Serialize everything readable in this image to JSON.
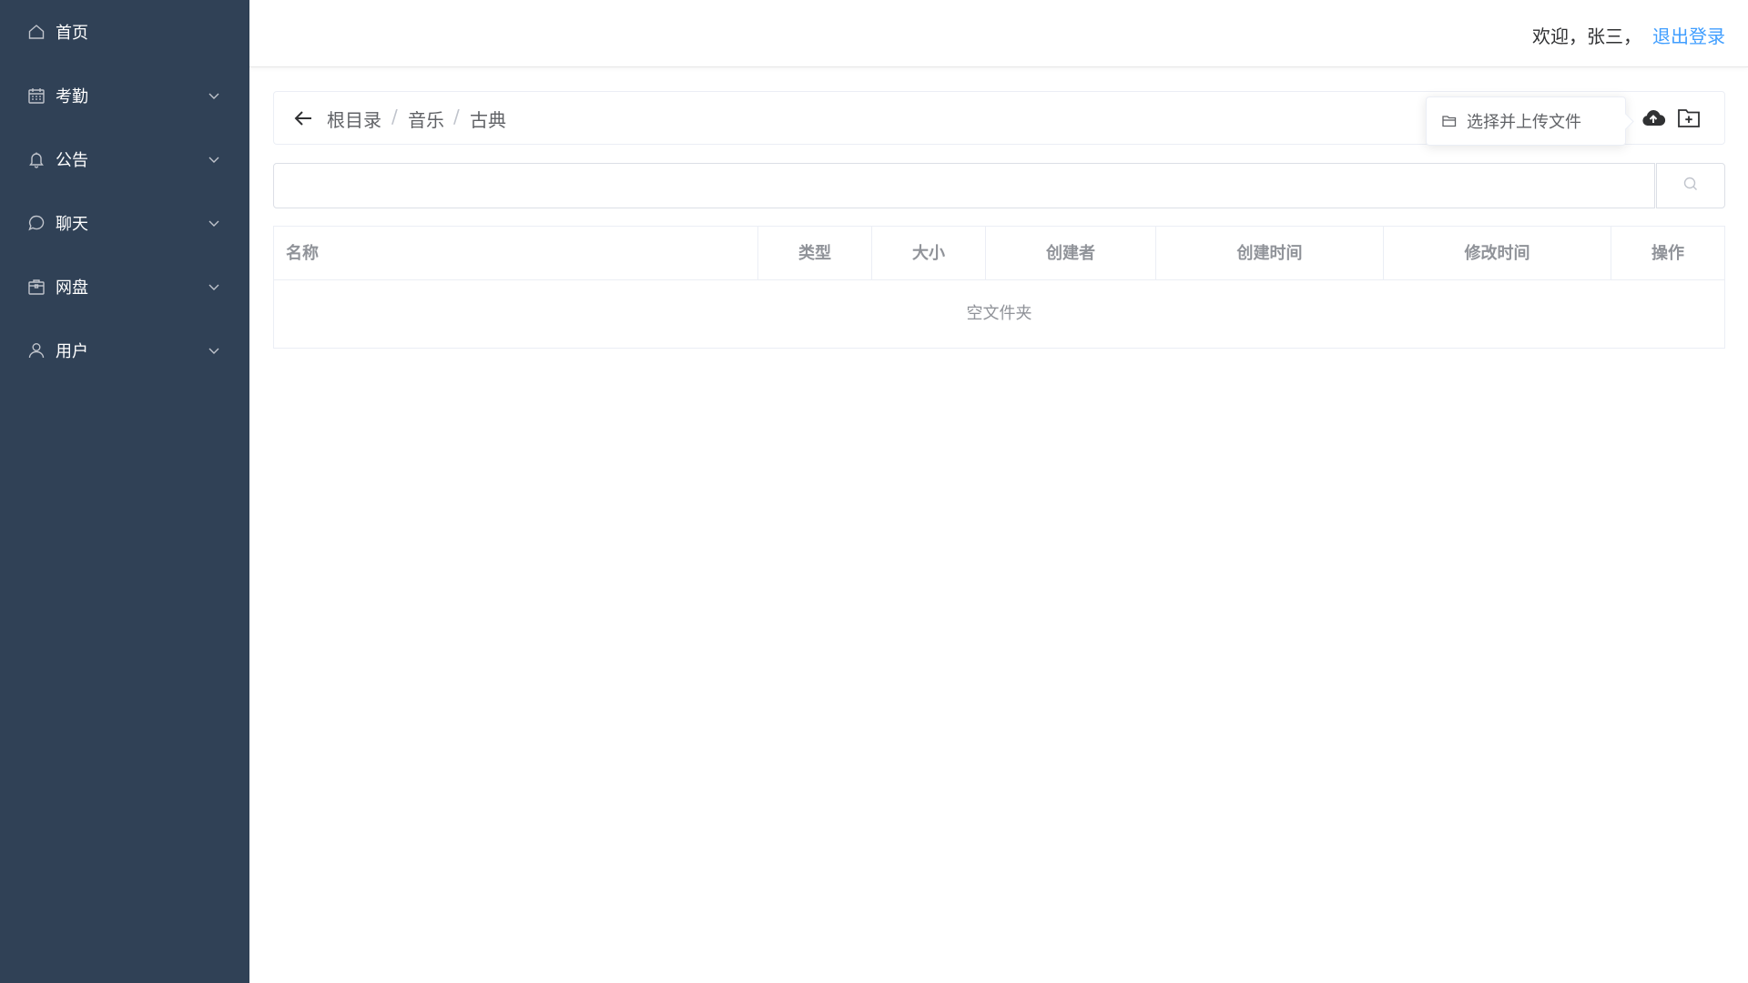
{
  "sidebar": {
    "items": [
      {
        "label": "首页",
        "icon": "home-icon",
        "has_submenu": false
      },
      {
        "label": "考勤",
        "icon": "calendar-icon",
        "has_submenu": true
      },
      {
        "label": "公告",
        "icon": "bell-icon",
        "has_submenu": true
      },
      {
        "label": "聊天",
        "icon": "chat-bubble-icon",
        "has_submenu": true
      },
      {
        "label": "网盘",
        "icon": "briefcase-icon",
        "has_submenu": true
      },
      {
        "label": "用户",
        "icon": "user-icon",
        "has_submenu": true
      }
    ],
    "background": "#304156"
  },
  "header": {
    "welcome": "欢迎，张三，",
    "logout": "退出登录",
    "accent": "#409eff"
  },
  "breadcrumb": {
    "items": [
      "根目录",
      "音乐",
      "古典"
    ],
    "separator": "/"
  },
  "upload_popover": {
    "label": "选择并上传文件",
    "icon": "folder-open-icon"
  },
  "toolbar_icons": [
    "cloud-upload-icon",
    "new-folder-icon"
  ],
  "search": {
    "value": "",
    "placeholder": "",
    "icon": "search-icon"
  },
  "table": {
    "columns": [
      "名称",
      "类型",
      "大小",
      "创建者",
      "创建时间",
      "修改时间",
      "操作"
    ],
    "rows": [],
    "empty_text": "空文件夹"
  }
}
